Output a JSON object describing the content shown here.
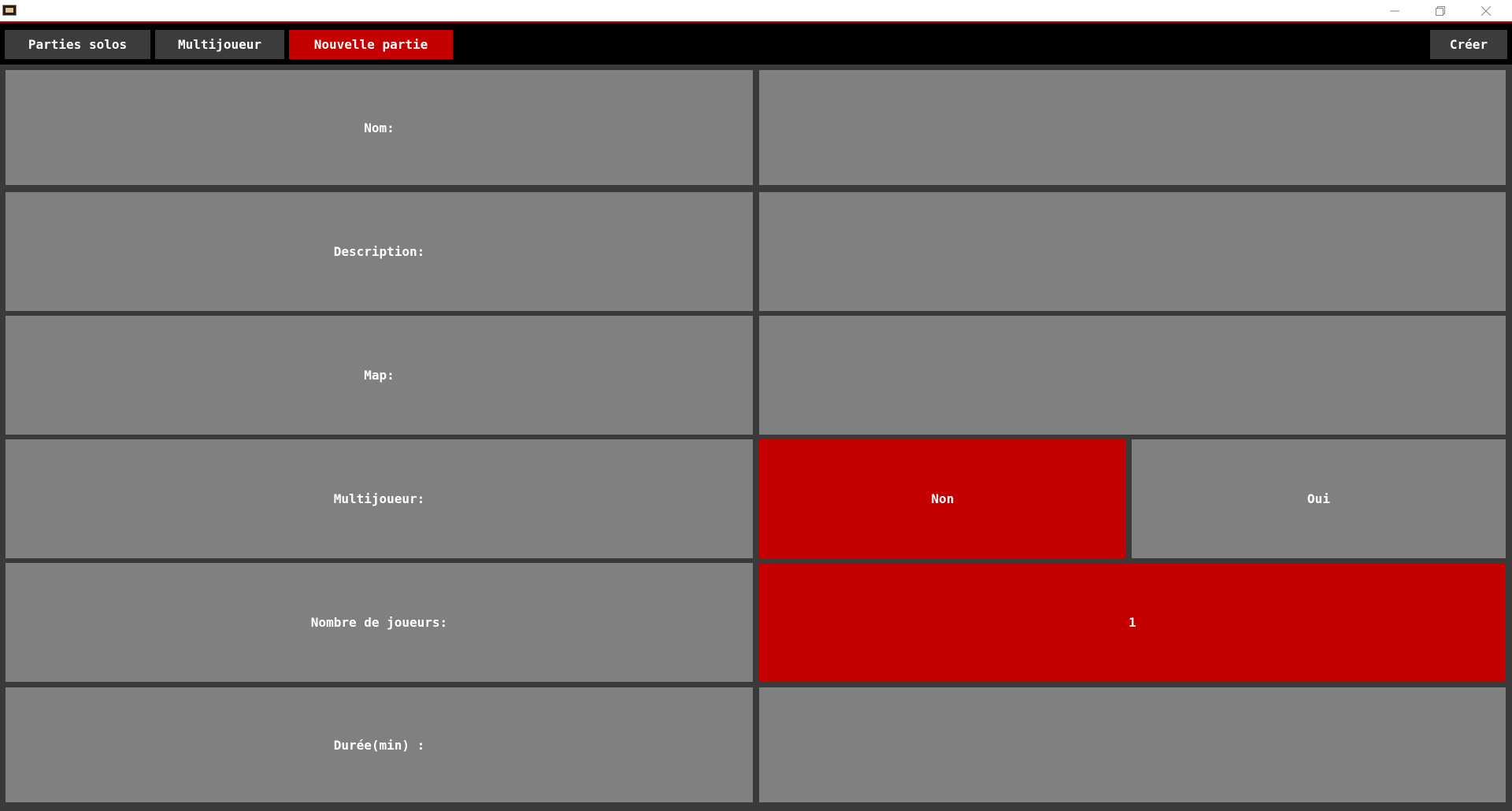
{
  "window": {
    "controls": {
      "minimize_icon": "minimize-icon",
      "restore_icon": "restore-icon",
      "close_icon": "close-icon"
    }
  },
  "tabs": [
    {
      "label": "Parties solos",
      "active": false
    },
    {
      "label": "Multijoueur",
      "active": false
    },
    {
      "label": "Nouvelle partie",
      "active": true
    }
  ],
  "toolbar": {
    "create_label": "Créer"
  },
  "form": {
    "name": {
      "label": "Nom:",
      "value": ""
    },
    "description": {
      "label": "Description:",
      "value": ""
    },
    "map": {
      "label": "Map:",
      "value": ""
    },
    "multiplayer": {
      "label": "Multijoueur:",
      "options": [
        {
          "label": "Non",
          "selected": true
        },
        {
          "label": "Oui",
          "selected": false
        }
      ]
    },
    "players": {
      "label": "Nombre de joueurs:",
      "value": "1"
    },
    "duration": {
      "label": "Durée(min) :",
      "value": ""
    }
  },
  "colors": {
    "accent": "#c40000",
    "cell": "#808080",
    "tab": "#3c3c3c",
    "background": "#3a3a3a",
    "topbar": "#000000"
  }
}
